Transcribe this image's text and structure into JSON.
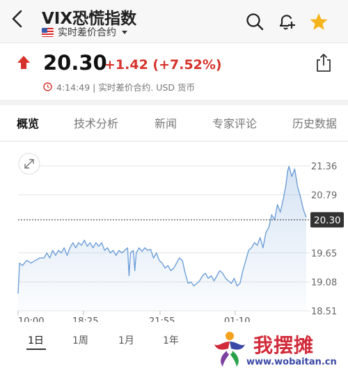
{
  "header": {
    "title": "VIX恐慌指数",
    "subtitle": "实时差价合约"
  },
  "quote": {
    "price": "20.30",
    "change": "+1.42 (+7.52%)",
    "time_info": "4:14:49 | 实时差价合约. USD 货币",
    "direction": "up"
  },
  "tabs": [
    {
      "label": "概览",
      "active": true
    },
    {
      "label": "技术分析",
      "active": false
    },
    {
      "label": "新闻",
      "active": false
    },
    {
      "label": "专家评论",
      "active": false
    },
    {
      "label": "历史数据",
      "active": false
    }
  ],
  "ranges": [
    {
      "label": "1日",
      "active": true
    },
    {
      "label": "1周",
      "active": false
    },
    {
      "label": "1月",
      "active": false
    },
    {
      "label": "1年",
      "active": false
    }
  ],
  "watermark": {
    "text": "我摆摊",
    "url": "www.wobaitan.cn"
  },
  "colors": {
    "up_red": "#d6322b",
    "line_blue": "#6e9fd8",
    "star_yellow": "#f5b41b"
  },
  "icons": [
    "back-icon",
    "flag-us-icon",
    "search-icon",
    "bell-plus-icon",
    "star-icon",
    "up-arrow-icon",
    "clock-icon",
    "share-icon",
    "expand-icon"
  ],
  "chart_data": {
    "type": "area",
    "x_ticks": [
      "10:00",
      "18:25",
      "21:55",
      "01:10"
    ],
    "y_ticks": [
      "21.36",
      "20.79",
      "19.65",
      "19.08",
      "18.51"
    ],
    "current_label": "20.30",
    "ylim": [
      18.51,
      21.36
    ],
    "xlim": [
      0,
      100
    ],
    "values": [
      [
        0,
        18.85
      ],
      [
        0.5,
        19.45
      ],
      [
        1.5,
        19.4
      ],
      [
        3,
        19.5
      ],
      [
        4.5,
        19.45
      ],
      [
        6,
        19.5
      ],
      [
        7.5,
        19.55
      ],
      [
        9,
        19.55
      ],
      [
        10,
        19.65
      ],
      [
        11,
        19.55
      ],
      [
        12,
        19.7
      ],
      [
        13,
        19.6
      ],
      [
        14,
        19.7
      ],
      [
        15,
        19.65
      ],
      [
        16,
        19.75
      ],
      [
        17,
        19.6
      ],
      [
        18,
        19.75
      ],
      [
        19,
        19.85
      ],
      [
        20,
        19.75
      ],
      [
        21,
        19.85
      ],
      [
        22,
        19.8
      ],
      [
        23,
        19.9
      ],
      [
        24,
        19.78
      ],
      [
        25,
        19.85
      ],
      [
        26,
        19.75
      ],
      [
        27,
        19.85
      ],
      [
        28,
        19.78
      ],
      [
        29,
        19.85
      ],
      [
        30,
        19.7
      ],
      [
        31,
        19.75
      ],
      [
        32,
        19.65
      ],
      [
        33,
        19.7
      ],
      [
        34,
        19.6
      ],
      [
        35,
        19.7
      ],
      [
        36,
        19.65
      ],
      [
        37,
        19.7
      ],
      [
        38,
        19.75
      ],
      [
        38.5,
        19.2
      ],
      [
        39,
        19.65
      ],
      [
        40,
        19.7
      ],
      [
        40.5,
        19.3
      ],
      [
        41,
        19.65
      ],
      [
        42,
        19.75
      ],
      [
        43,
        19.68
      ],
      [
        44,
        19.75
      ],
      [
        45,
        19.7
      ],
      [
        46,
        19.72
      ],
      [
        47,
        19.55
      ],
      [
        48,
        19.65
      ],
      [
        49,
        19.5
      ],
      [
        50,
        19.45
      ],
      [
        51,
        19.35
      ],
      [
        52,
        19.4
      ],
      [
        53,
        19.3
      ],
      [
        54,
        19.35
      ],
      [
        55,
        19.45
      ],
      [
        56,
        19.55
      ],
      [
        57,
        19.5
      ],
      [
        58,
        19.25
      ],
      [
        59,
        19.05
      ],
      [
        60,
        19.08
      ],
      [
        61,
        19.0
      ],
      [
        62,
        19.05
      ],
      [
        63,
        19.1
      ],
      [
        64,
        19.2
      ],
      [
        65,
        19.25
      ],
      [
        66,
        19.15
      ],
      [
        67,
        19.2
      ],
      [
        68,
        19.1
      ],
      [
        69,
        19.2
      ],
      [
        70,
        19.3
      ],
      [
        71,
        19.25
      ],
      [
        72,
        19.15
      ],
      [
        73,
        19.1
      ],
      [
        74,
        19.05
      ],
      [
        75,
        19.15
      ],
      [
        76,
        19.0
      ],
      [
        77,
        19.05
      ],
      [
        78,
        19.3
      ],
      [
        79,
        19.5
      ],
      [
        80,
        19.7
      ],
      [
        81,
        19.75
      ],
      [
        82,
        19.85
      ],
      [
        83,
        19.8
      ],
      [
        84,
        19.95
      ],
      [
        85,
        19.75
      ],
      [
        86,
        20.05
      ],
      [
        87,
        20.15
      ],
      [
        88,
        20.4
      ],
      [
        89,
        20.3
      ],
      [
        90,
        20.6
      ],
      [
        91,
        20.45
      ],
      [
        92,
        20.7
      ],
      [
        93,
        21.0
      ],
      [
        93.5,
        21.25
      ],
      [
        94,
        21.35
      ],
      [
        95,
        21.15
      ],
      [
        96,
        21.3
      ],
      [
        97,
        20.95
      ],
      [
        98,
        20.75
      ],
      [
        99,
        20.5
      ],
      [
        100,
        20.35
      ]
    ]
  }
}
